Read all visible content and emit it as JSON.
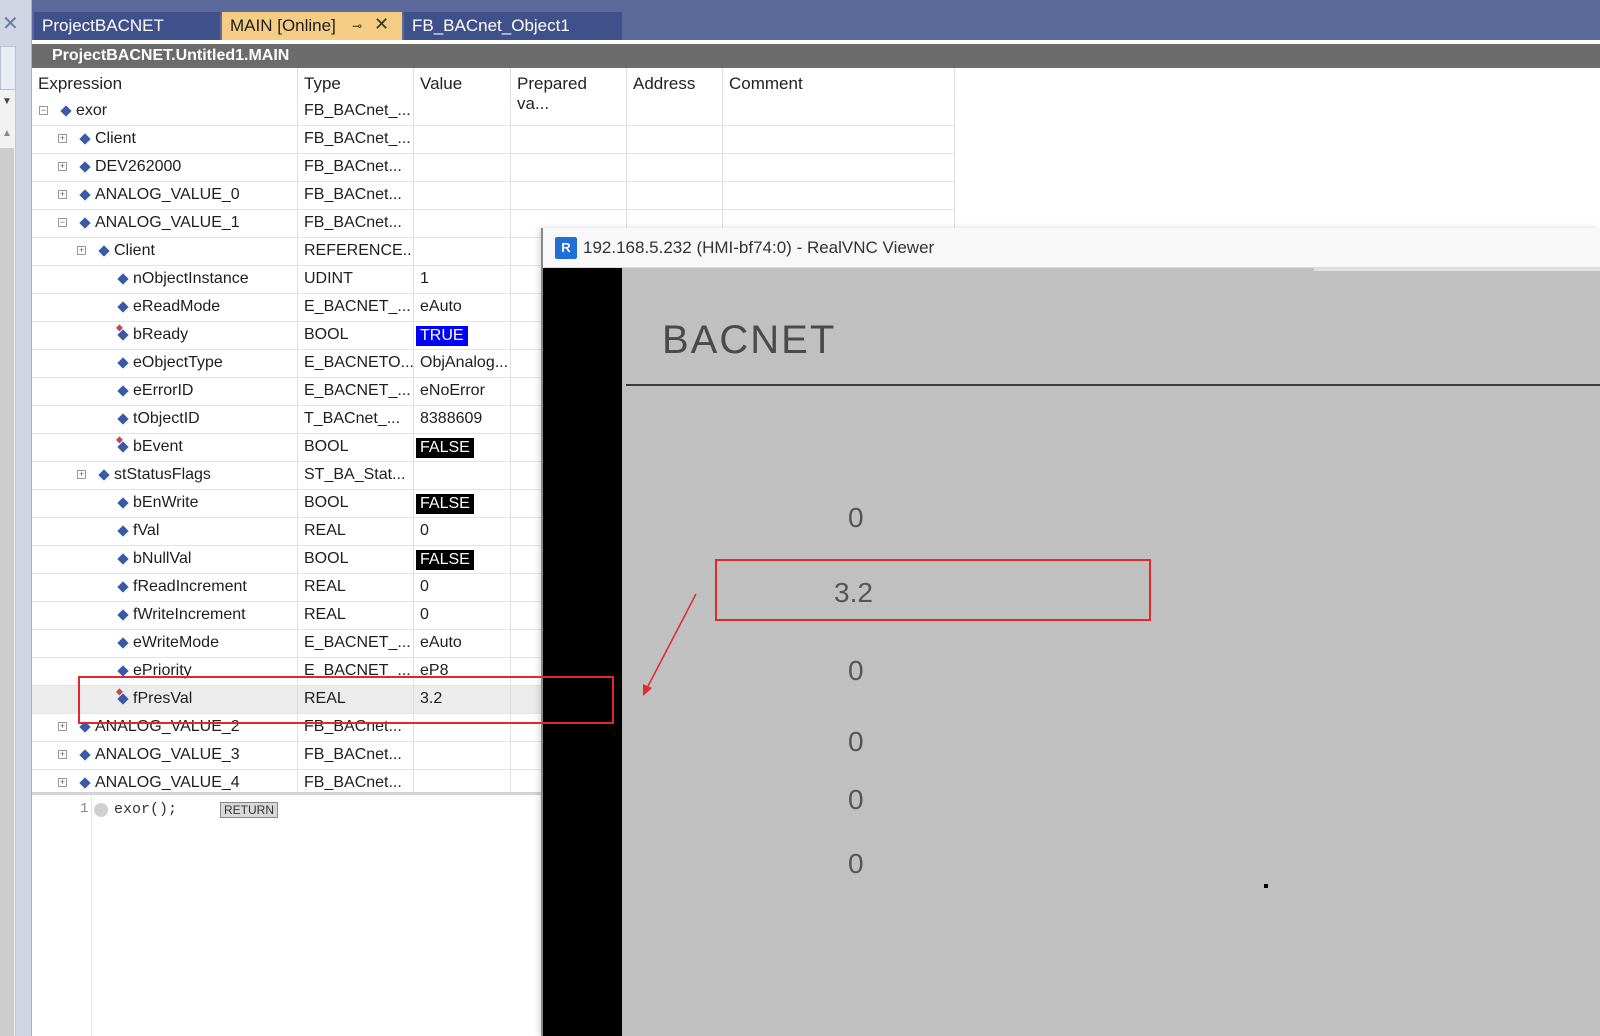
{
  "tabs": [
    {
      "label": "ProjectBACNET"
    },
    {
      "label": "MAIN [Online]"
    },
    {
      "label": "FB_BACnet_Object1"
    }
  ],
  "editor_title": "ProjectBACNET.Untitled1.MAIN",
  "watch": {
    "columns": [
      "Expression",
      "Type",
      "Value",
      "Prepared va...",
      "Address",
      "Comment"
    ],
    "rows": [
      {
        "expr": "exor",
        "type": "FB_BACnet_...",
        "value": ""
      },
      {
        "expr": "Client",
        "type": "FB_BACnet_...",
        "value": ""
      },
      {
        "expr": "DEV262000",
        "type": "FB_BACnet...",
        "value": ""
      },
      {
        "expr": "ANALOG_VALUE_0",
        "type": "FB_BACnet...",
        "value": ""
      },
      {
        "expr": "ANALOG_VALUE_1",
        "type": "FB_BACnet...",
        "value": ""
      },
      {
        "expr": "Client",
        "type": "REFERENCE...",
        "value": ""
      },
      {
        "expr": "nObjectInstance",
        "type": "UDINT",
        "value": "1"
      },
      {
        "expr": "eReadMode",
        "type": "E_BACNET_...",
        "value": "eAuto"
      },
      {
        "expr": "bReady",
        "type": "BOOL",
        "value": "TRUE"
      },
      {
        "expr": "eObjectType",
        "type": "E_BACNETO...",
        "value": "ObjAnalog..."
      },
      {
        "expr": "eErrorID",
        "type": "E_BACNET_...",
        "value": "eNoError"
      },
      {
        "expr": "tObjectID",
        "type": "T_BACnet_...",
        "value": "8388609"
      },
      {
        "expr": "bEvent",
        "type": "BOOL",
        "value": "FALSE"
      },
      {
        "expr": "stStatusFlags",
        "type": "ST_BA_Stat...",
        "value": ""
      },
      {
        "expr": "bEnWrite",
        "type": "BOOL",
        "value": "FALSE"
      },
      {
        "expr": "fVal",
        "type": "REAL",
        "value": "0"
      },
      {
        "expr": "bNullVal",
        "type": "BOOL",
        "value": "FALSE"
      },
      {
        "expr": "fReadIncrement",
        "type": "REAL",
        "value": "0"
      },
      {
        "expr": "fWriteIncrement",
        "type": "REAL",
        "value": "0"
      },
      {
        "expr": "eWriteMode",
        "type": "E_BACNET_...",
        "value": "eAuto"
      },
      {
        "expr": "ePriority",
        "type": "E_BACNET_...",
        "value": "eP8"
      },
      {
        "expr": "fPresVal",
        "type": "REAL",
        "value": "3.2"
      },
      {
        "expr": "ANALOG_VALUE_2",
        "type": "FB_BACnet...",
        "value": ""
      },
      {
        "expr": "ANALOG_VALUE_3",
        "type": "FB_BACnet...",
        "value": ""
      },
      {
        "expr": "ANALOG_VALUE_4",
        "type": "FB_BACnet...",
        "value": ""
      }
    ]
  },
  "code": {
    "line_number": "1",
    "text": "exor();",
    "return_label": "RETURN"
  },
  "vnc": {
    "title": "192.168.5.232 (HMI-bf74:0) - RealVNC Viewer",
    "logo_text": "R",
    "hmi_header": "BACNET",
    "values": [
      "0",
      "3.2",
      "0",
      "0",
      "0",
      "0"
    ]
  },
  "colors": {
    "tab_active": "#f5cc84",
    "tab_inactive": "#40508a",
    "true_badge": "#0000ff",
    "false_badge": "#000000",
    "annotation": "#e0292e"
  },
  "icons": [
    "close-icon",
    "pin-icon",
    "variable-icon",
    "expand-icon",
    "collapse-icon",
    "vnc-logo-icon",
    "breakpoint-icon"
  ]
}
